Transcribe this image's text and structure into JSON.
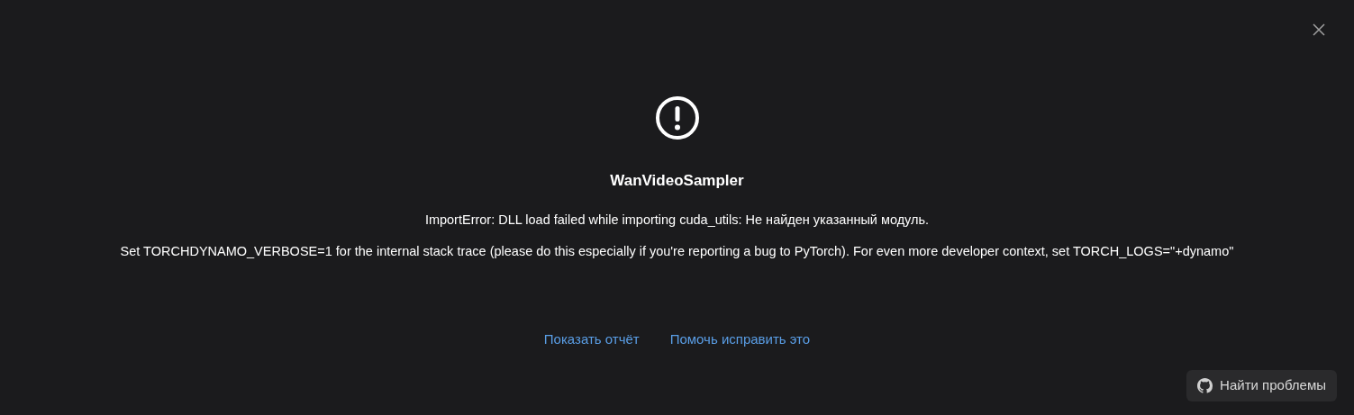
{
  "dialog": {
    "title": "WanVideoSampler",
    "messages": [
      "ImportError: DLL load failed while importing cuda_utils: Не найден указанный модуль.",
      "Set TORCHDYNAMO_VERBOSE=1 for the internal stack trace (please do this especially if you're reporting a bug to PyTorch). For even more developer context, set TORCH_LOGS=\"+dynamo\""
    ],
    "links": [
      "Показать отчёт",
      "Помочь исправить это"
    ],
    "find_issues_button": "Найти проблемы"
  }
}
